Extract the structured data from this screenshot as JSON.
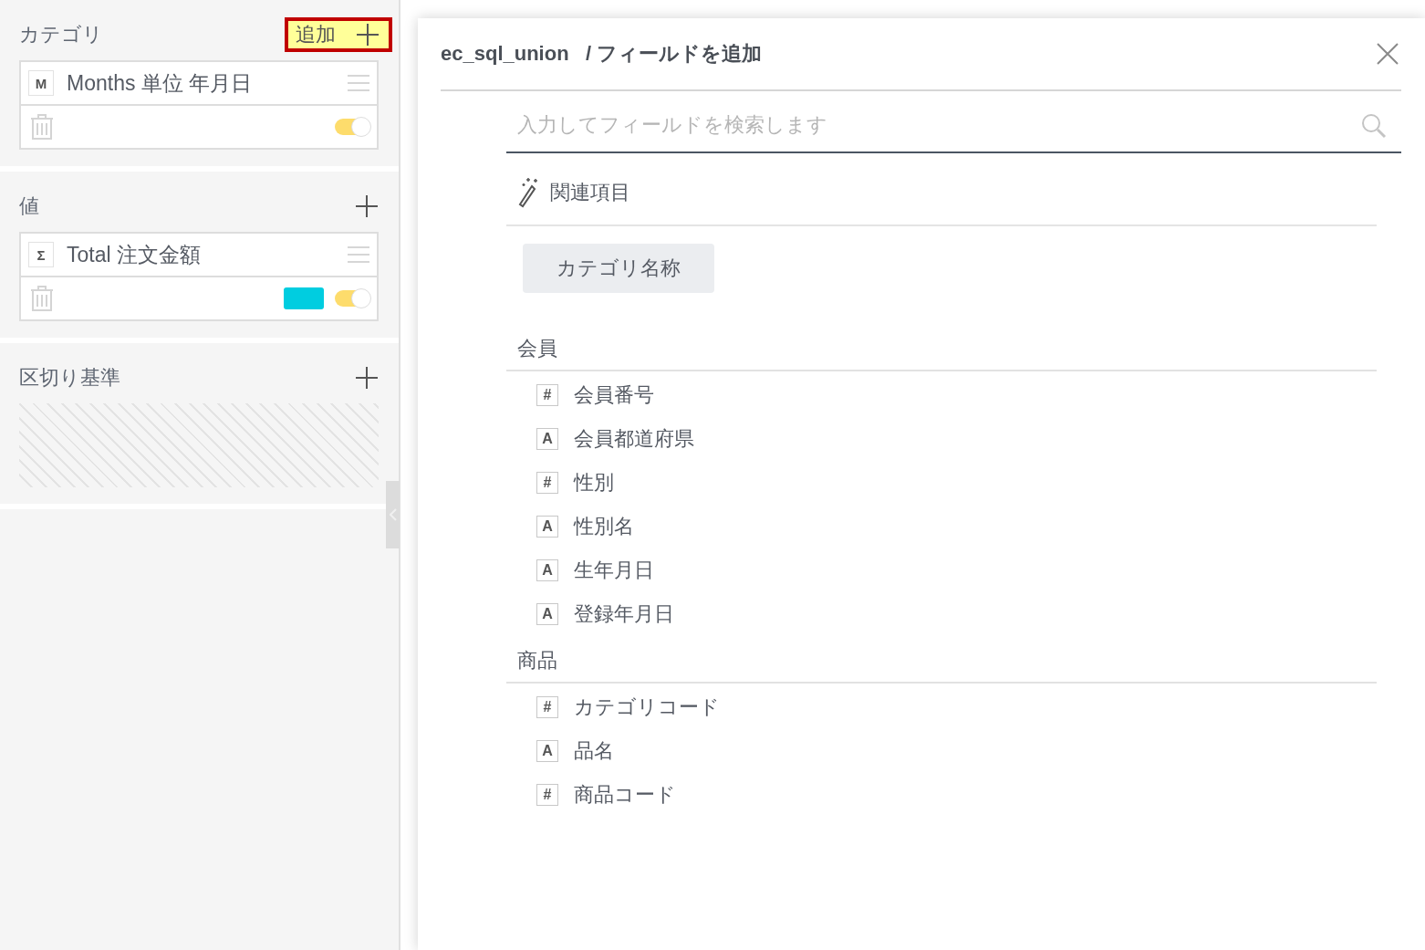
{
  "sections": [
    {
      "title": "カテゴリ",
      "add_label": "追加",
      "highlighted": true,
      "fields": [
        {
          "badge": "M",
          "name": "Months 単位 年月日",
          "on": true
        }
      ]
    },
    {
      "title": "値",
      "highlighted": false,
      "fields": [
        {
          "badge": "Σ",
          "name": "Total 注文金額",
          "color": "#00cde0",
          "on": true
        }
      ]
    },
    {
      "title": "区切り基準",
      "highlighted": false
    }
  ],
  "dialog": {
    "dataset": "ec_sql_union",
    "title": "/ フィールドを追加",
    "search": {
      "placeholder": "入力してフィールドを検索します"
    },
    "related": {
      "label": "関連項目",
      "chips": [
        "カテゴリ名称"
      ]
    },
    "groups": [
      {
        "name": "会員",
        "fields": [
          {
            "badge": "#",
            "label": "会員番号"
          },
          {
            "badge": "A",
            "label": "会員都道府県"
          },
          {
            "badge": "#",
            "label": "性別"
          },
          {
            "badge": "A",
            "label": "性別名"
          },
          {
            "badge": "A",
            "label": "生年月日"
          },
          {
            "badge": "A",
            "label": "登録年月日"
          }
        ]
      },
      {
        "name": "商品",
        "fields": [
          {
            "badge": "#",
            "label": "カテゴリコード"
          },
          {
            "badge": "A",
            "label": "品名"
          },
          {
            "badge": "#",
            "label": "商品コード"
          }
        ]
      }
    ]
  }
}
